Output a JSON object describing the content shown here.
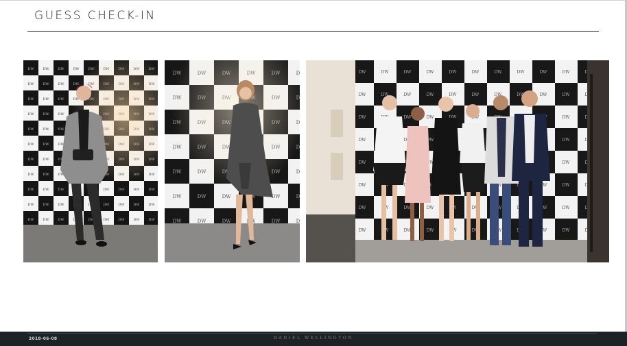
{
  "slide": {
    "title": "GUESS CHECK-IN"
  },
  "photos": [
    {
      "name": "guest-photo-1",
      "description_icon": "photo-icon"
    },
    {
      "name": "guest-photo-2",
      "description_icon": "photo-icon"
    },
    {
      "name": "group-photo",
      "description_icon": "photo-icon"
    }
  ],
  "footer": {
    "date": "2018-06-08",
    "brand": "DANIEL WELLINGTON"
  },
  "colors": {
    "footer_bg": "#1d2227",
    "brand_gold": "#8a7d6a",
    "title_text": "#1e1e1e"
  }
}
